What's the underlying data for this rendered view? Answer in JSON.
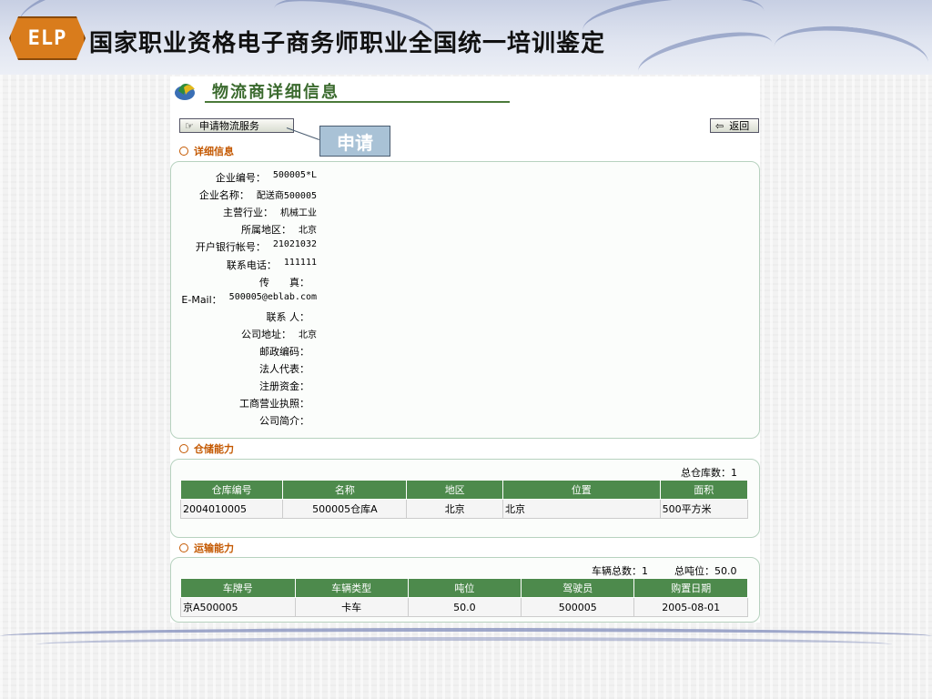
{
  "slide": {
    "logo_text": "ELP",
    "title": "国家职业资格电子商务师职业全国统一培训鉴定"
  },
  "page": {
    "title": "物流商详细信息",
    "apply_button": "申请物流服务",
    "callout": "申请",
    "return_button": "返回"
  },
  "details": {
    "section_title": "详细信息",
    "fields": [
      {
        "label": "企业编号：",
        "value": "500005*L"
      },
      {
        "label": "企业名称：",
        "value": "配送商500005"
      },
      {
        "label": "主营行业：",
        "value": "机械工业"
      },
      {
        "label": "所属地区：",
        "value": "北京"
      },
      {
        "label": "开户银行帐号：",
        "value": "21021032"
      },
      {
        "label": "联系电话：",
        "value": "111111"
      },
      {
        "label": "传　　真：",
        "value": ""
      },
      {
        "label": "E-Mail：",
        "value": "500005@eblab.com"
      },
      {
        "label": "联系 人：",
        "value": ""
      },
      {
        "label": "公司地址：",
        "value": "北京"
      },
      {
        "label": "邮政编码：",
        "value": ""
      },
      {
        "label": "法人代表：",
        "value": ""
      },
      {
        "label": "注册资金：",
        "value": ""
      },
      {
        "label": "工商营业执照：",
        "value": ""
      },
      {
        "label": "公司简介：",
        "value": ""
      }
    ]
  },
  "warehouse": {
    "section_title": "仓储能力",
    "summary": "总仓库数：1",
    "columns": [
      "仓库编号",
      "名称",
      "地区",
      "位置",
      "面积"
    ],
    "rows": [
      [
        "2004010005",
        "500005仓库A",
        "北京",
        "北京",
        "500平方米"
      ]
    ]
  },
  "transport": {
    "section_title": "运输能力",
    "summary_vehicles": "车辆总数：1",
    "summary_tonnage": "总吨位：50.0",
    "columns": [
      "车牌号",
      "车辆类型",
      "吨位",
      "驾驶员",
      "购置日期"
    ],
    "rows": [
      [
        "京A500005",
        "卡车",
        "50.0",
        "500005",
        "2005-08-01"
      ]
    ]
  }
}
